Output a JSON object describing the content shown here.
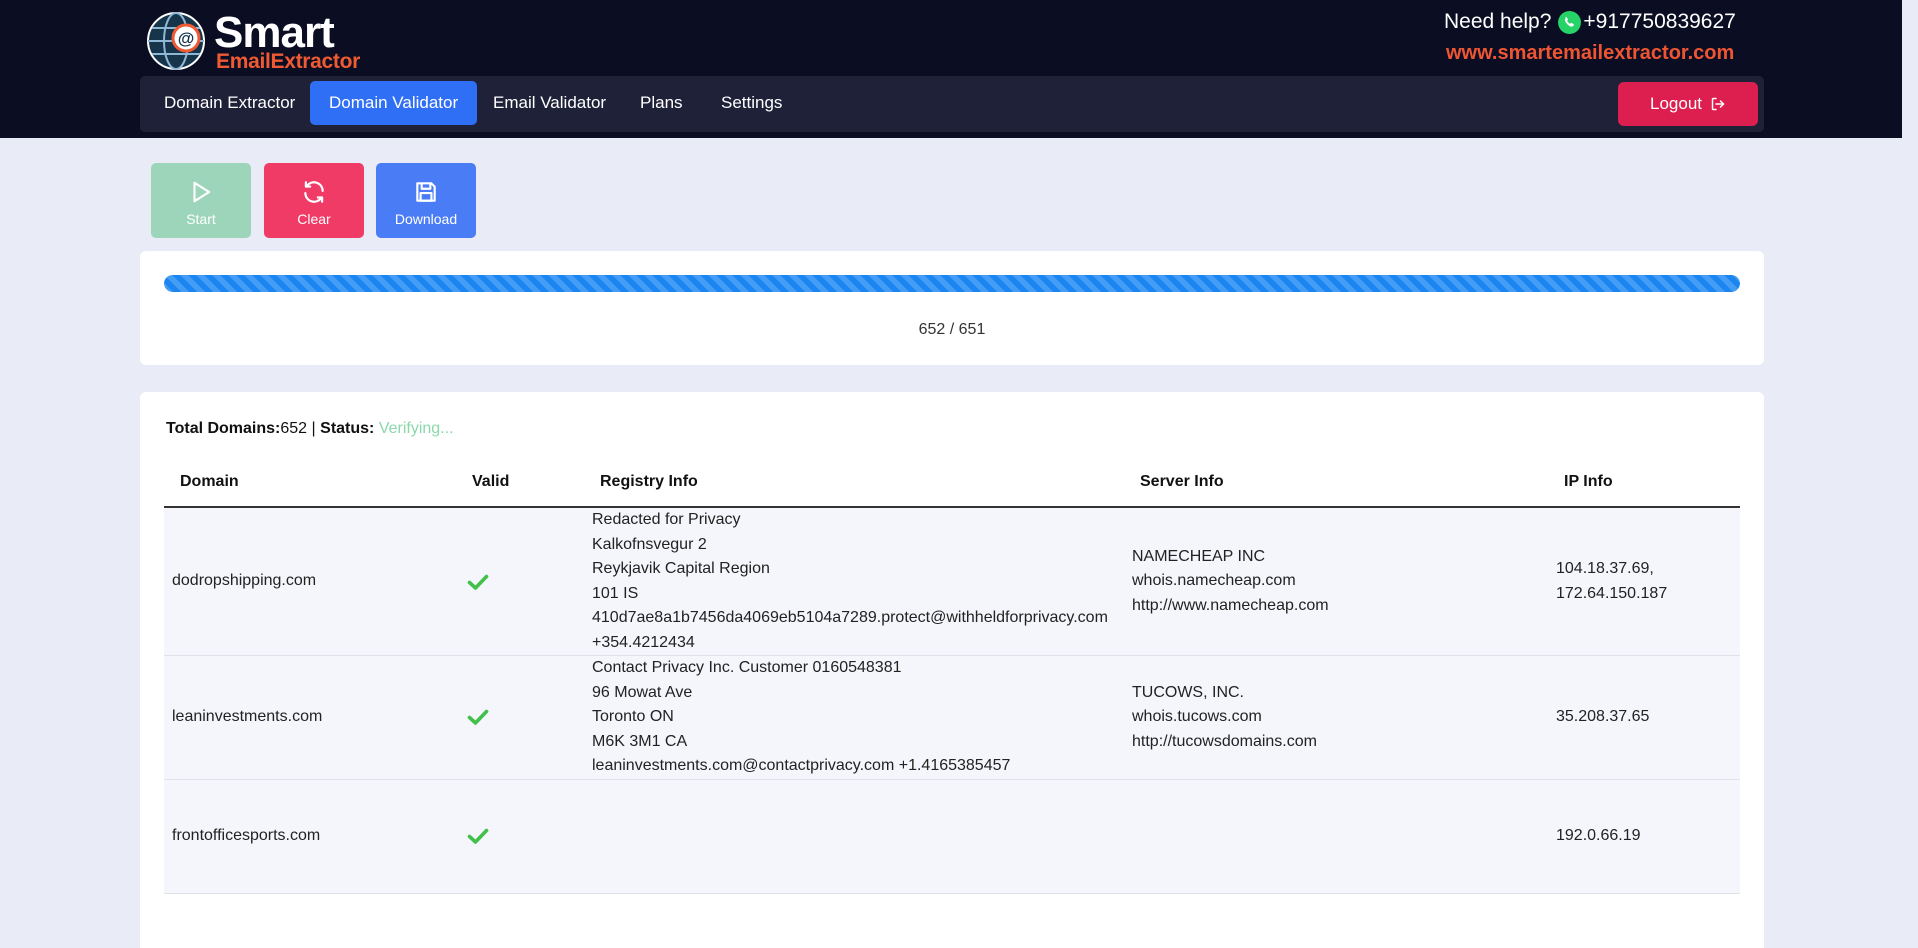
{
  "brand": {
    "name_top": "Smart",
    "name_sub": "EmailExtractor",
    "help_text": "Need help?",
    "phone": "+917750839627",
    "website": "www.smartemailextractor.com"
  },
  "nav": {
    "items": [
      {
        "label": "Domain Extractor",
        "active": false
      },
      {
        "label": "Domain Validator",
        "active": true
      },
      {
        "label": "Email Validator",
        "active": false
      },
      {
        "label": "Plans",
        "active": false
      },
      {
        "label": "Settings",
        "active": false
      }
    ],
    "logout_label": "Logout"
  },
  "actions": {
    "start_label": "Start",
    "clear_label": "Clear",
    "download_label": "Download"
  },
  "progress": {
    "text": "652 / 651",
    "fraction": 1.0
  },
  "summary": {
    "total_label": "Total Domains:",
    "total_value": "652",
    "separator": "|",
    "status_label": "Status:",
    "status_value": "Verifying..."
  },
  "table": {
    "headers": [
      "Domain",
      "Valid",
      "Registry Info",
      "Server Info",
      "IP Info"
    ],
    "rows": [
      {
        "domain": "dodropshipping.com",
        "valid": true,
        "registry": [
          "Redacted for Privacy",
          "Kalkofnsvegur 2",
          "Reykjavik Capital Region",
          "101 IS",
          "410d7ae8a1b7456da4069eb5104a7289.protect@withheldforprivacy.com",
          "+354.4212434"
        ],
        "server": [
          "NAMECHEAP INC",
          "whois.namecheap.com",
          "http://www.namecheap.com"
        ],
        "ip": [
          "104.18.37.69,",
          "172.64.150.187"
        ]
      },
      {
        "domain": "leaninvestments.com",
        "valid": true,
        "registry": [
          "Contact Privacy Inc. Customer 0160548381",
          "96 Mowat Ave",
          "Toronto ON",
          "M6K 3M1 CA",
          "leaninvestments.com@contactprivacy.com +1.4165385457"
        ],
        "server": [
          "TUCOWS, INC.",
          "whois.tucows.com",
          "http://tucowsdomains.com"
        ],
        "ip": [
          "35.208.37.65"
        ]
      },
      {
        "domain": "frontofficesports.com",
        "valid": true,
        "registry": [],
        "server": [],
        "ip": [
          "192.0.66.19"
        ]
      }
    ]
  },
  "colors": {
    "topbar": "#0b0d22",
    "accent": "#2f6ff5",
    "logout": "#dc1f4e",
    "brand_orange": "#f05a33",
    "success": "#41c04a",
    "status_text": "#8ad8aa"
  }
}
